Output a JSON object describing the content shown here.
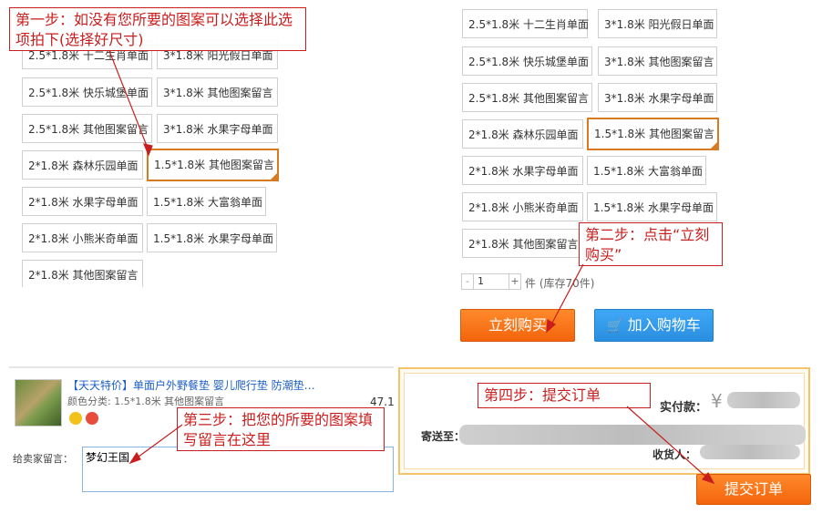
{
  "left_options": [
    "2.5*1.8米 十二生肖单面",
    "3*1.8米 阳光假日单面",
    "2.5*1.8米 快乐城堡单面",
    "3*1.8米 其他图案留言",
    "2.5*1.8米 其他图案留言",
    "3*1.8米 水果字母单面",
    "2*1.8米 森林乐园单面",
    "1.5*1.8米 其他图案留言",
    "2*1.8米 水果字母单面",
    "1.5*1.8米 大富翁单面",
    "2*1.8米 小熊米奇单面",
    "1.5*1.8米 水果字母单面",
    "2*1.8米 其他图案留言"
  ],
  "right_options": [
    "2.5*1.8米 十二生肖单面",
    "3*1.8米 阳光假日单面",
    "2.5*1.8米 快乐城堡单面",
    "3*1.8米 其他图案留言",
    "2.5*1.8米 其他图案留言",
    "3*1.8米 水果字母单面",
    "2*1.8米 森林乐园单面",
    "1.5*1.8米 其他图案留言",
    "2*1.8米 水果字母单面",
    "1.5*1.8米 大富翁单面",
    "2*1.8米 小熊米奇单面",
    "1.5*1.8米 水果字母单面",
    "2*1.8米 其他图案留言"
  ],
  "notes": {
    "step1": "第一步：如没有您所要的图案可以选择此选项拍下(选择好尺寸)",
    "step2": "第二步：点击“立刻购买”",
    "step3": "第三步：把您的所要的图案填写留言在这里",
    "step4": "第四步：提交订单"
  },
  "purchase": {
    "quantity": "1",
    "unit": "件",
    "stock": "(库存70件)",
    "minus": "-",
    "plus": "+",
    "buy_label": "立刻购买",
    "cart_label": "加入购物车"
  },
  "order_item": {
    "title": "【天天特价】单面户外野餐垫 婴儿爬行垫 防潮垫…",
    "color_label": "颜色分类: 1.5*1.8米 其他图案留言",
    "price": "47.1",
    "message_label": "给卖家留言：",
    "message_value": "梦幻王国"
  },
  "submit": {
    "pay_label": "实付款：",
    "currency": "¥",
    "ship_label": "寄送至：",
    "receiver_label": "收货人：",
    "submit_label": "提交订单"
  },
  "colors": {
    "accent": "#f4640c",
    "note_red": "#c81e1e",
    "selected_border": "#d77a21",
    "link_blue": "#2a8ee0"
  }
}
